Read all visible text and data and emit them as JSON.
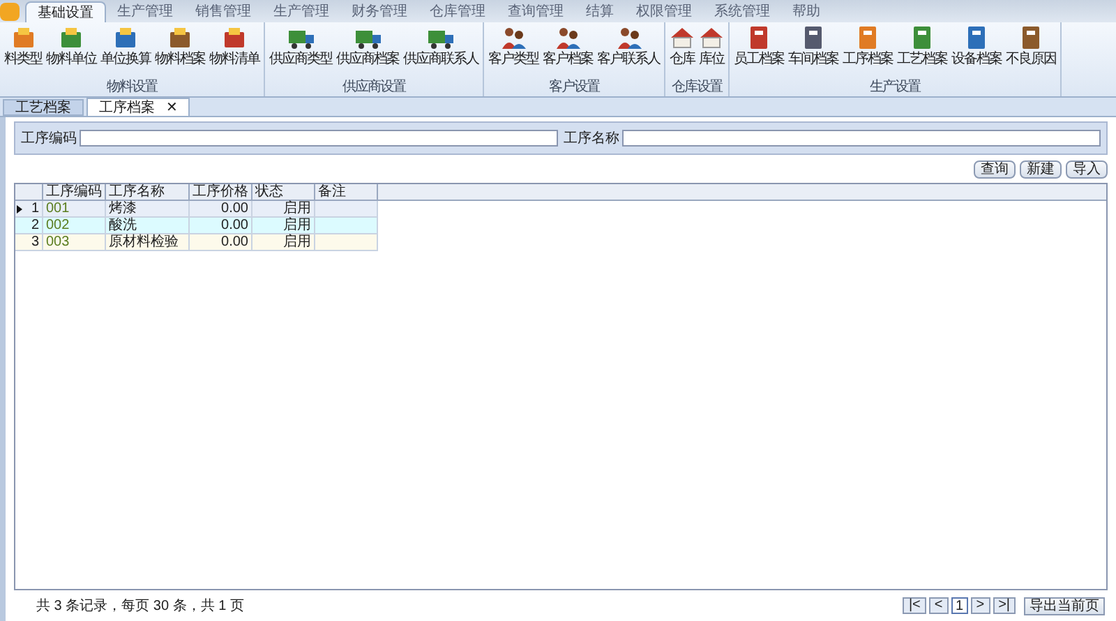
{
  "ribbon_tabs": [
    {
      "label": "基础设置",
      "selected": true
    },
    {
      "label": "生产管理",
      "selected": false
    },
    {
      "label": "销售管理",
      "selected": false
    },
    {
      "label": "生产管理",
      "selected": false
    },
    {
      "label": "财务管理",
      "selected": false
    },
    {
      "label": "仓库管理",
      "selected": false
    },
    {
      "label": "查询管理",
      "selected": false
    },
    {
      "label": "结算",
      "selected": false
    },
    {
      "label": "权限管理",
      "selected": false
    },
    {
      "label": "系统管理",
      "selected": false
    },
    {
      "label": "帮助",
      "selected": false
    }
  ],
  "ribbon_groups": [
    {
      "title": "物料设置",
      "items": [
        "料类型",
        "物料单位",
        "单位换算",
        "物料档案",
        "物料清单"
      ]
    },
    {
      "title": "供应商设置",
      "items": [
        "供应商类型",
        "供应商档案",
        "供应商联系人"
      ]
    },
    {
      "title": "客户设置",
      "items": [
        "客户类型",
        "客户档案",
        "客户联系人"
      ]
    },
    {
      "title": "仓库设置",
      "items": [
        "仓库",
        "库位"
      ]
    },
    {
      "title": "生产设置",
      "items": [
        "员工档案",
        "车间档案",
        "工序档案",
        "工艺档案",
        "设备档案",
        "不良原因"
      ]
    }
  ],
  "doc_tabs": [
    {
      "label": "工艺档案",
      "selected": false
    },
    {
      "label": "工序档案",
      "selected": true,
      "close": "✕"
    }
  ],
  "filters": [
    {
      "label": "工序编码"
    },
    {
      "label": "工序名称"
    }
  ],
  "buttons": [
    "查询",
    "新建",
    "导入"
  ],
  "table": {
    "columns": [
      "工序编码",
      "工序名称",
      "工序价格",
      "状态",
      "备注"
    ],
    "rows": [
      {
        "index": "1",
        "selected": true,
        "cells": [
          "001",
          "烤漆",
          "0.00",
          "启用",
          ""
        ]
      },
      {
        "index": "2",
        "selected": false,
        "cells": [
          "002",
          "酸洗",
          "0.00",
          "启用",
          ""
        ]
      },
      {
        "index": "3",
        "selected": false,
        "cells": [
          "003",
          "原材料检验",
          "0.00",
          "启用",
          ""
        ]
      }
    ]
  },
  "status_bar": {
    "summary": "共 3 条记录，每页 30 条，共 1 页",
    "pager": [
      "|<",
      "<",
      ">",
      ">|"
    ],
    "page": "1",
    "export": "导出当前页"
  }
}
